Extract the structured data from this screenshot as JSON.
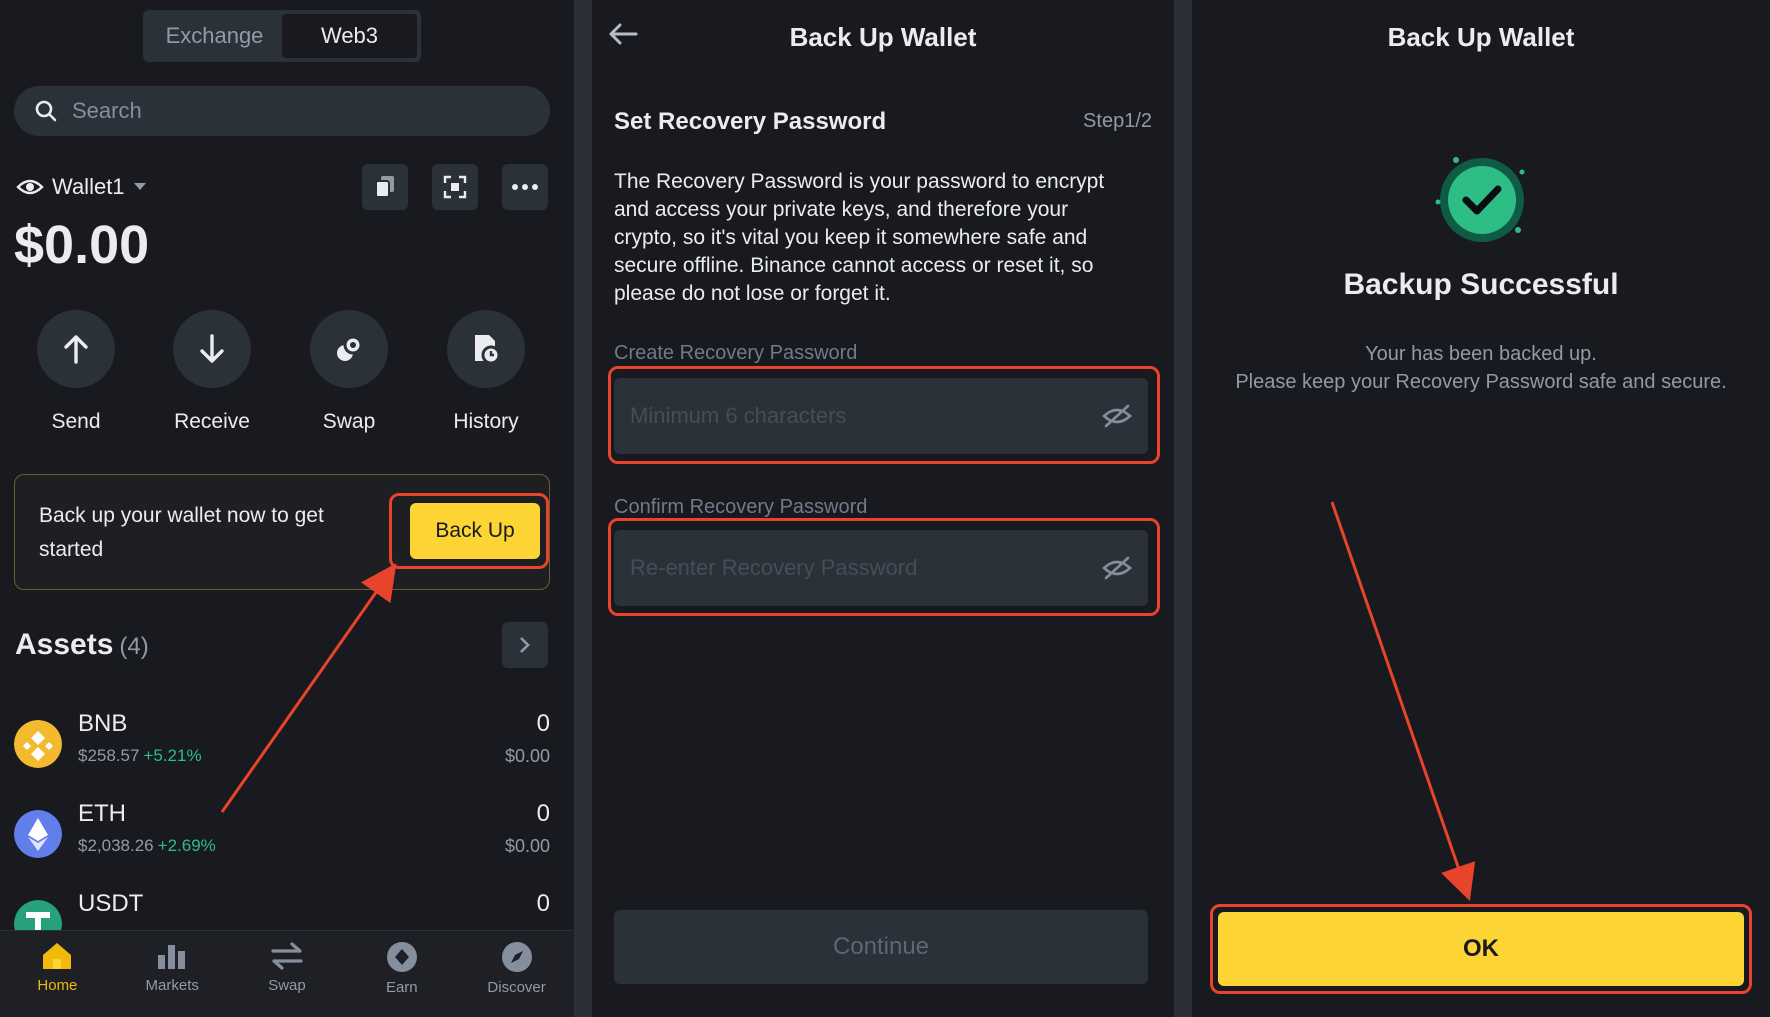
{
  "wallet_screen": {
    "segment": {
      "exchange": "Exchange",
      "web3": "Web3"
    },
    "search_placeholder": "Search",
    "wallet_name": "Wallet1",
    "balance": "$0.00",
    "actions": [
      {
        "label": "Send",
        "icon": "arrow-up-icon"
      },
      {
        "label": "Receive",
        "icon": "arrow-down-icon"
      },
      {
        "label": "Swap",
        "icon": "swap-icon"
      },
      {
        "label": "History",
        "icon": "history-icon"
      }
    ],
    "backup_banner": {
      "text": "Back up your wallet now to get started",
      "button": "Back Up"
    },
    "assets": {
      "title": "Assets",
      "count": "(4)",
      "items": [
        {
          "name": "BNB",
          "price": "$258.57",
          "change": "+5.21%",
          "amount": "0",
          "usd": "$0.00",
          "color": "#f3ba2f"
        },
        {
          "name": "ETH",
          "price": "$2,038.26",
          "change": "+2.69%",
          "amount": "0",
          "usd": "$0.00",
          "color": "#627eea"
        },
        {
          "name": "USDT",
          "price": "",
          "change": "",
          "amount": "0",
          "usd": "",
          "color": "#26a17b"
        }
      ]
    },
    "tabbar": [
      {
        "label": "Home",
        "icon": "home-icon",
        "active": true
      },
      {
        "label": "Markets",
        "icon": "markets-icon"
      },
      {
        "label": "Swap",
        "icon": "swap-arrows-icon"
      },
      {
        "label": "Earn",
        "icon": "earn-icon"
      },
      {
        "label": "Discover",
        "icon": "discover-icon"
      }
    ]
  },
  "password_screen": {
    "title": "Back Up Wallet",
    "section_title": "Set Recovery Password",
    "step": "Step1/2",
    "description": "The Recovery Password is your password to encrypt and access your private keys, and therefore your crypto, so it's vital you keep it somewhere safe and secure offline. Binance cannot access or reset it, so please do not lose or forget it.",
    "create_label": "Create Recovery Password",
    "create_placeholder": "Minimum 6 characters",
    "confirm_label": "Confirm Recovery Password",
    "confirm_placeholder": "Re-enter Recovery Password",
    "continue_button": "Continue"
  },
  "success_screen": {
    "title": "Back Up Wallet",
    "heading": "Backup Successful",
    "line1": "Your has been backed up.",
    "line2": "Please keep your Recovery Password safe and secure.",
    "ok_button": "OK"
  },
  "colors": {
    "accent": "#fcd535",
    "background": "#181a20",
    "annotation": "#e8432b",
    "success": "#2ebd85"
  }
}
